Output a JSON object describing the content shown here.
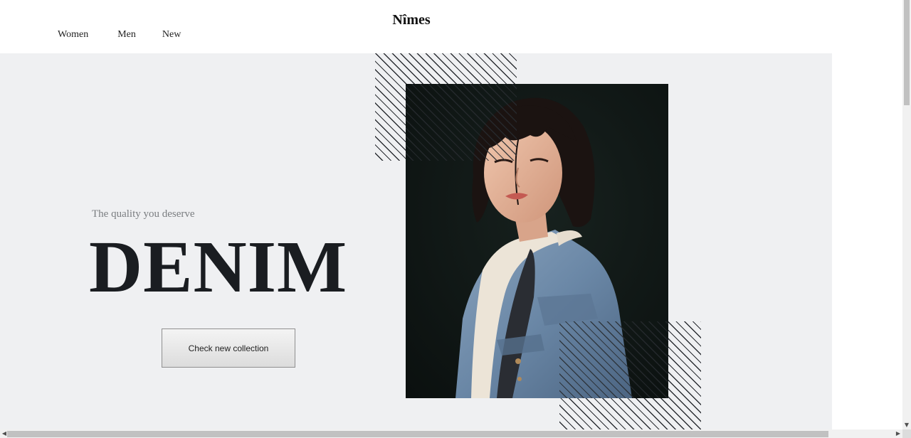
{
  "header": {
    "brand": "Nîmes",
    "nav": [
      {
        "label": "Women"
      },
      {
        "label": "Men"
      },
      {
        "label": "New"
      }
    ]
  },
  "hero": {
    "tagline": "The quality you deserve",
    "headline": "DENIM",
    "cta_label": "Check new collection",
    "photo_icon": "model-in-denim-jacket-photo",
    "background_color": "#eff0f2",
    "headline_color": "#1a1d21"
  },
  "scrollbars": {
    "up_arrow": "▲",
    "down_arrow": "▼",
    "left_arrow": "◀",
    "right_arrow": "▶"
  }
}
